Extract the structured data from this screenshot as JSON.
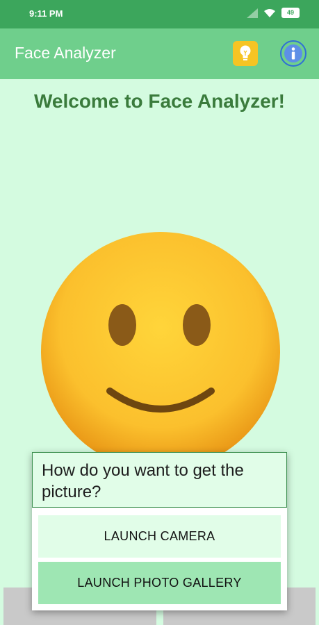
{
  "status_bar": {
    "time": "9:11 PM",
    "battery": "49"
  },
  "app_bar": {
    "title": "Face Analyzer",
    "tips_icon": "lightbulb-icon",
    "info_icon": "info-icon"
  },
  "main": {
    "welcome_text": "Welcome to Face Analyzer!",
    "image": "smiley-face"
  },
  "dialog": {
    "question": "How do you want to get the picture?",
    "camera_button": "LAUNCH CAMERA",
    "gallery_button": "LAUNCH PHOTO GALLERY"
  },
  "colors": {
    "background": "#d4fbe0",
    "status_bar": "#3ca65c",
    "app_bar": "#6fcf8c",
    "welcome_text": "#3a7b3c",
    "gallery_button": "#9ee6b3"
  }
}
